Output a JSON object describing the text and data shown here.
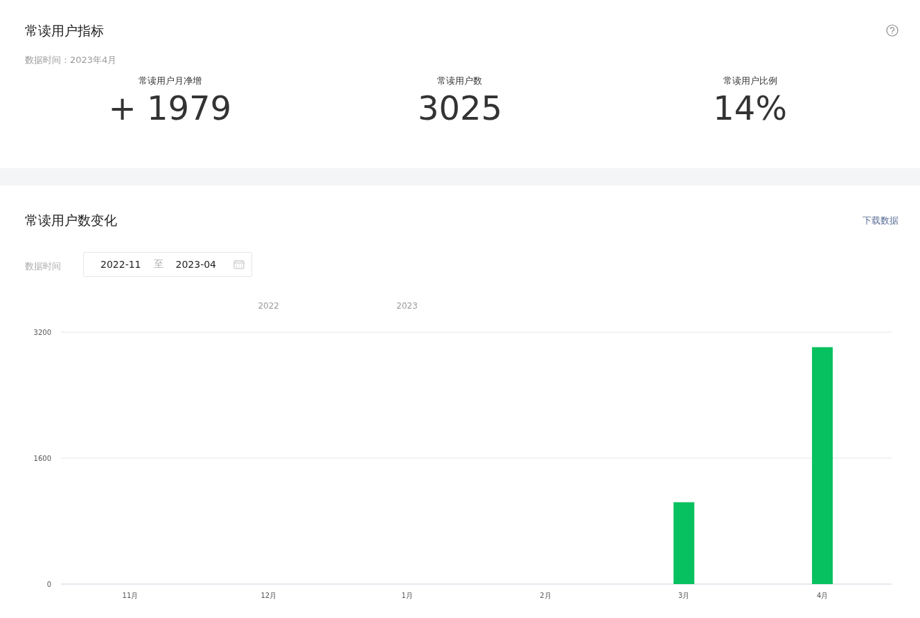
{
  "metrics_card": {
    "title": "常读用户指标",
    "data_time": "数据时间：2023年4月",
    "metrics": [
      {
        "label": "常读用户月净增",
        "value": "+ 1979"
      },
      {
        "label": "常读用户数",
        "value": "3025"
      },
      {
        "label": "常读用户比例",
        "value": "14%"
      }
    ]
  },
  "trend_card": {
    "title": "常读用户数变化",
    "download_link": "下载数据",
    "filter_label": "数据时间",
    "date_range": {
      "start": "2022-11",
      "separator": "至",
      "end": "2023-04"
    },
    "chart_data": {
      "type": "bar",
      "categories": [
        "11月",
        "12月",
        "1月",
        "2月",
        "3月",
        "4月"
      ],
      "series": [
        {
          "color": "#07c160",
          "values": [
            0,
            0,
            0,
            0,
            1040,
            3010
          ]
        }
      ],
      "ylim": [
        0,
        3200
      ],
      "yticks": [
        0,
        1600,
        3200
      ],
      "annotations": [
        "2022",
        "2023"
      ]
    }
  }
}
